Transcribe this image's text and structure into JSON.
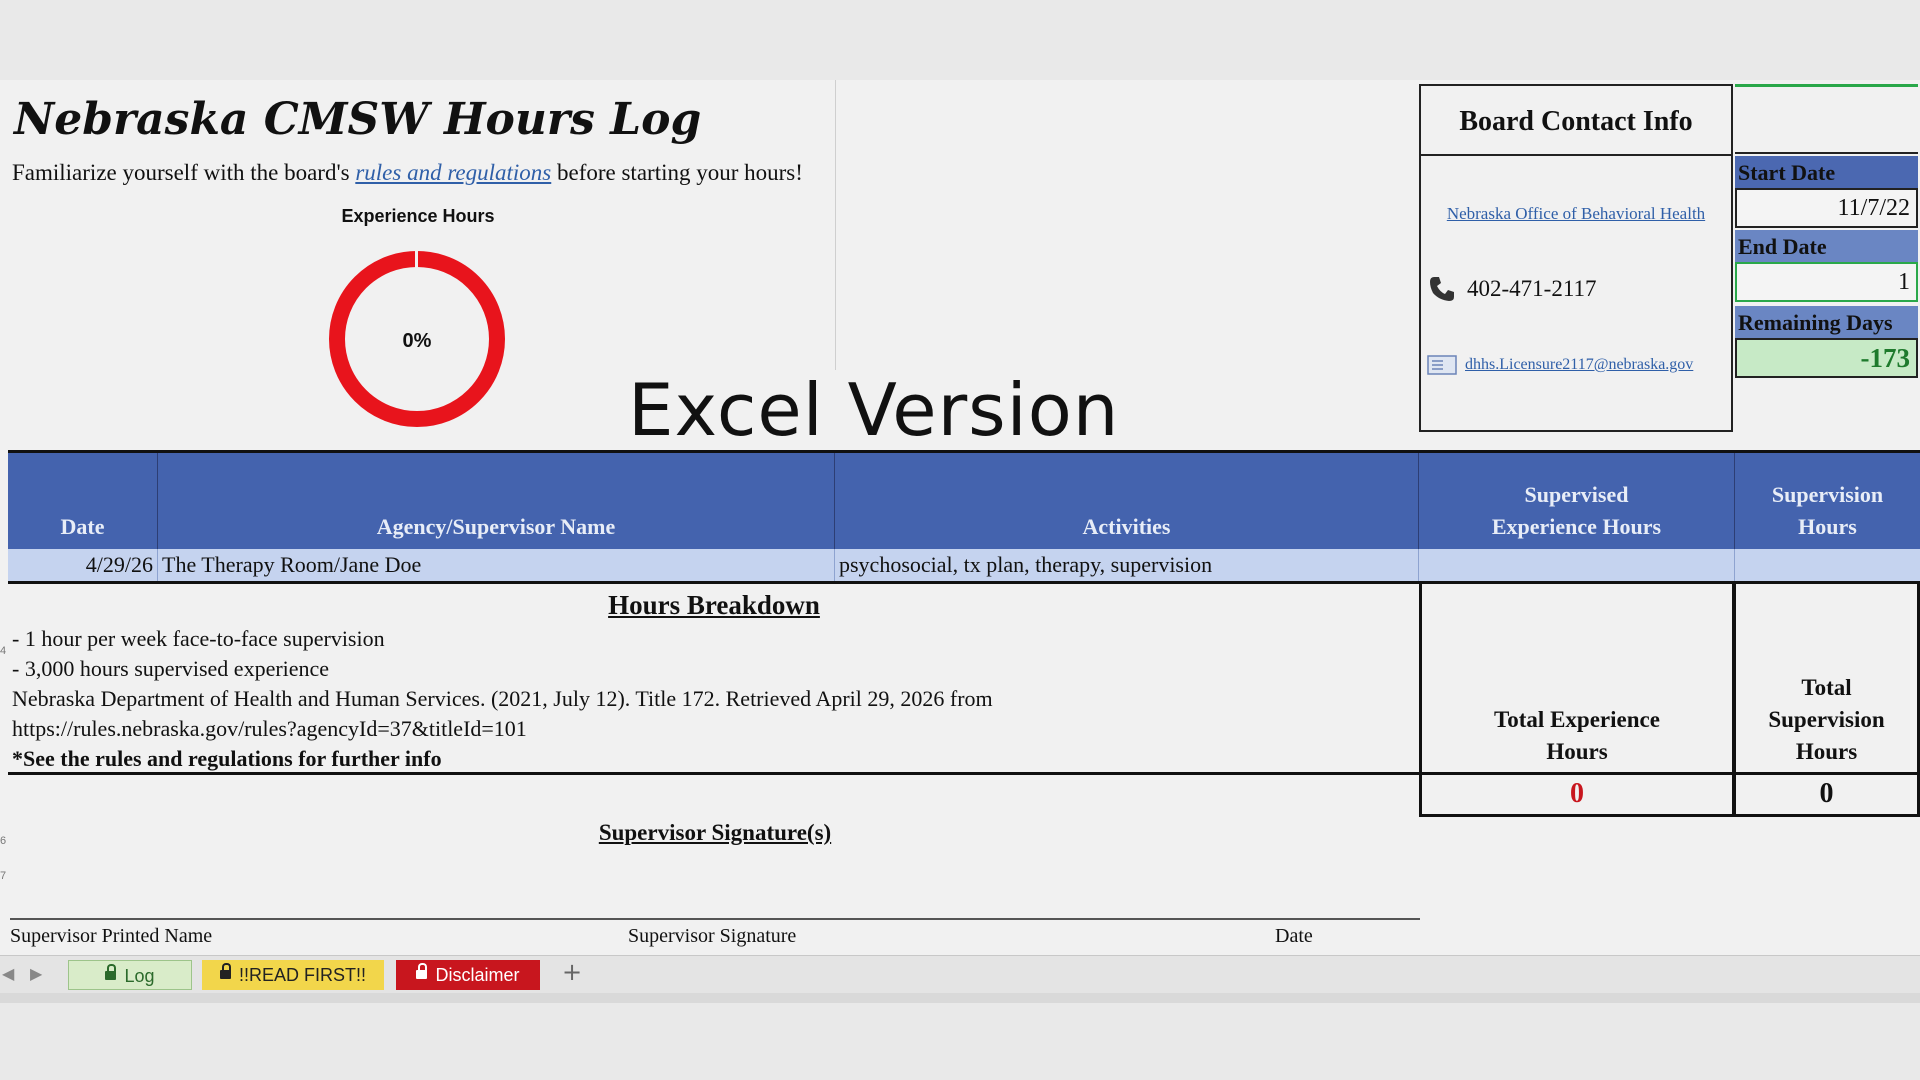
{
  "header": {
    "title": "Nebraska CMSW Hours Log",
    "intro_prefix": "Familiarize yourself with the board's ",
    "intro_link": "rules and regulations",
    "intro_suffix": " before starting your hours!",
    "watermark": "Excel Version"
  },
  "gauge": {
    "title": "Experience Hours",
    "percent_label": "0%",
    "progress": 0,
    "ring_color": "#e8141c"
  },
  "contact": {
    "heading": "Board Contact Info",
    "office_link": "Nebraska Office of Behavioral Health",
    "phone": "402-471-2117",
    "email": "dhhs.Licensure2117@nebraska.gov"
  },
  "dates": {
    "start_label": "Start Date",
    "start_value": "11/7/22",
    "end_label": "End Date",
    "end_value": "1",
    "remaining_label": "Remaining Days",
    "remaining_value": "-173"
  },
  "table": {
    "columns": [
      "Date",
      "Agency/Supervisor Name",
      "Activities",
      "Supervised Experience Hours",
      "Supervision Hours"
    ],
    "rows": [
      {
        "date": "4/29/26",
        "agency": "The Therapy Room/Jane Doe",
        "activities": "psychosocial, tx plan, therapy, supervision",
        "exp_hours": "",
        "sup_hours": ""
      }
    ]
  },
  "breakdown": {
    "title": "Hours Breakdown",
    "lines": [
      "- 1 hour per week face-to-face supervision",
      "- 3,000 hours supervised experience",
      "Nebraska Department of Health and Human Services. (2021, July 12). Title 172. Retrieved April 29, 2026 from",
      "https://rules.nebraska.gov/rules?agencyId=37&titleId=101",
      "*See the rules and regulations for further info"
    ]
  },
  "totals": {
    "experience_label": "Total Experience Hours",
    "experience_value": "0",
    "supervision_label": "Total Supervision Hours",
    "supervision_value": "0"
  },
  "signature": {
    "title": "Supervisor Signature(s)",
    "printed_name": "Supervisor Printed Name",
    "signature": "Supervisor Signature",
    "date": "Date"
  },
  "tabs": [
    {
      "label": "Log",
      "color": "#d9ecc9",
      "text": "#2b6a2b"
    },
    {
      "label": "!!READ FIRST!!",
      "color": "#f2d64b",
      "text": "#222222"
    },
    {
      "label": "Disclaimer",
      "color": "#c8161e",
      "text": "#ffffff"
    }
  ],
  "colors": {
    "header_blue": "#4463ae",
    "row_blue": "#c5d3ef",
    "remaining_green": "#c7eac6",
    "total_red": "#c8161e"
  }
}
